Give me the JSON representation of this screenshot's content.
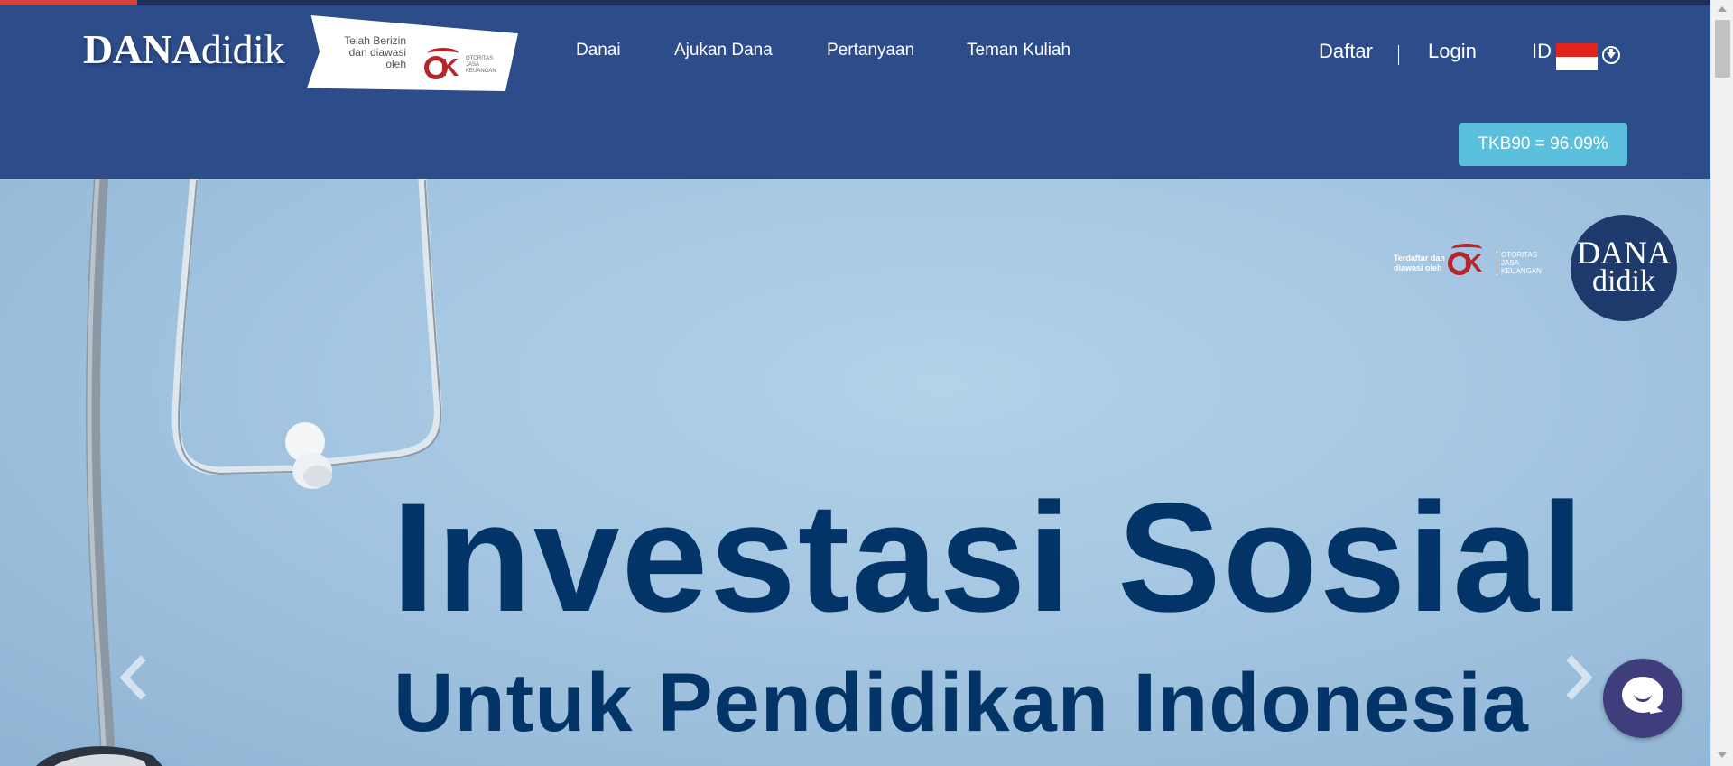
{
  "page": {
    "scroll_progress_pct": 8
  },
  "header": {
    "brand": {
      "bold": "DANA",
      "light": "didik"
    },
    "ojk_badge": {
      "registered_text": "Telah Berizin dan diawasi oleh",
      "ojk_line1": "OTORITAS",
      "ojk_line2": "JASA",
      "ojk_line3": "KEUANGAN"
    },
    "nav": [
      "Danai",
      "Ajukan Dana",
      "Pertanyaan",
      "Teman Kuliah"
    ],
    "auth": {
      "register": "Daftar",
      "login": "Login"
    },
    "language": {
      "code": "ID",
      "flag": "indonesia-flag-icon"
    },
    "tkb_button": "TKB90 = 96.09%"
  },
  "hero": {
    "title": "Investasi Sosial",
    "subtitle": "Untuk Pendidikan Indonesia",
    "ojk_registered_text": "Terdaftar dan diawasi oleh",
    "ojk_line1": "OTORITAS",
    "ojk_line2": "JASA",
    "ojk_line3": "KEUANGAN",
    "logo_line1": "DANA",
    "logo_line2": "didik",
    "prev_icon": "chevron-left-icon",
    "next_icon": "chevron-right-icon"
  },
  "chat_widget": {
    "icon": "chat-bubble-icon"
  },
  "colors": {
    "header_bg": "#2d4c8a",
    "hero_text": "#033468",
    "tkb_bg": "#5bc0de",
    "flag_red": "#e2231a",
    "ojk_red": "#b3262b",
    "chat_bg": "#3f3e7c"
  }
}
